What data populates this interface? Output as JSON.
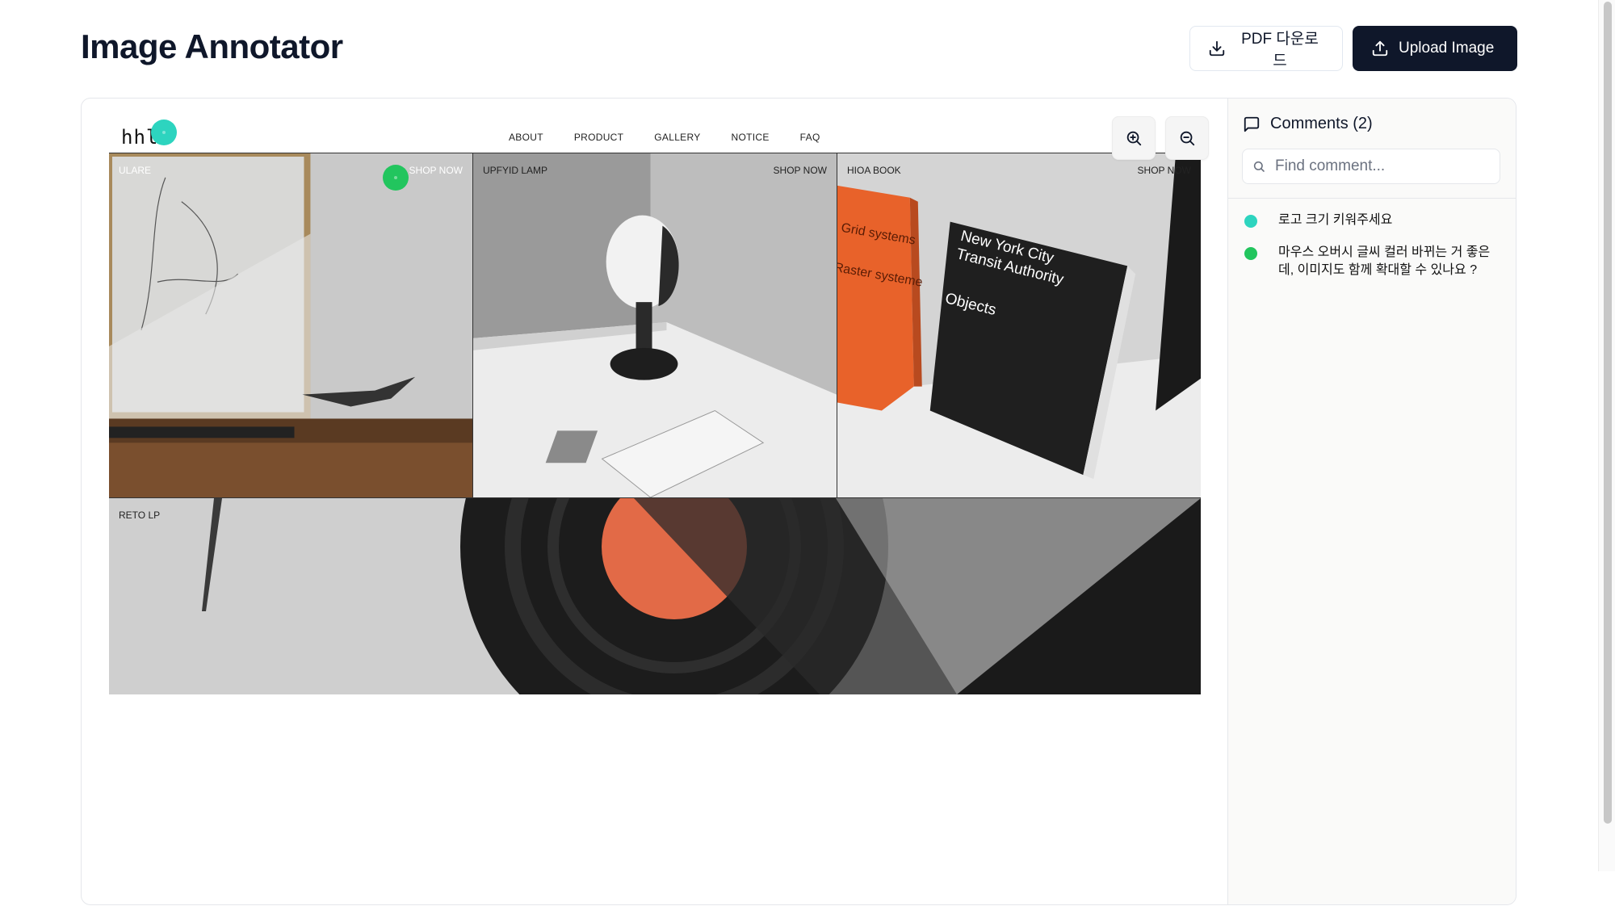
{
  "app": {
    "title": "Image Annotator"
  },
  "toolbar": {
    "pdf_label": "PDF 다운로드",
    "upload_label": "Upload Image"
  },
  "preview": {
    "logo": "hhl",
    "nav": [
      "ABOUT",
      "PRODUCT",
      "GALLERY",
      "NOTICE",
      "FAQ"
    ],
    "tiles": [
      {
        "label": "ULARE",
        "shop": "SHOP NOW"
      },
      {
        "label": "UPFYID LAMP",
        "shop": "SHOP NOW"
      },
      {
        "label": "HIOA BOOK",
        "shop": "SHOP NOW"
      }
    ],
    "banner_label": "RETO LP",
    "book_text": {
      "orange_a": "Grid systems",
      "orange_b": "Raster systeme",
      "black_a": "New York City",
      "black_b": "Transit Authority",
      "black_c": "Objects"
    }
  },
  "markers": [
    {
      "color": "#2dd4bf"
    },
    {
      "color": "#22c55e"
    }
  ],
  "comments": {
    "title": "Comments (2)",
    "search_placeholder": "Find comment...",
    "items": [
      {
        "text": "로고 크기 키워주세요",
        "color": "#2dd4bf"
      },
      {
        "text": "마우스 오버시 글씨 컬러 바뀌는 거 좋은데, 이미지도 함께 확대할 수 있나요 ?",
        "color": "#22c55e"
      }
    ]
  },
  "icons": {
    "download": "download-icon",
    "upload": "upload-icon",
    "comment": "message-square-icon",
    "search": "search-icon",
    "zoom_in": "zoom-in-icon",
    "zoom_out": "zoom-out-icon"
  }
}
